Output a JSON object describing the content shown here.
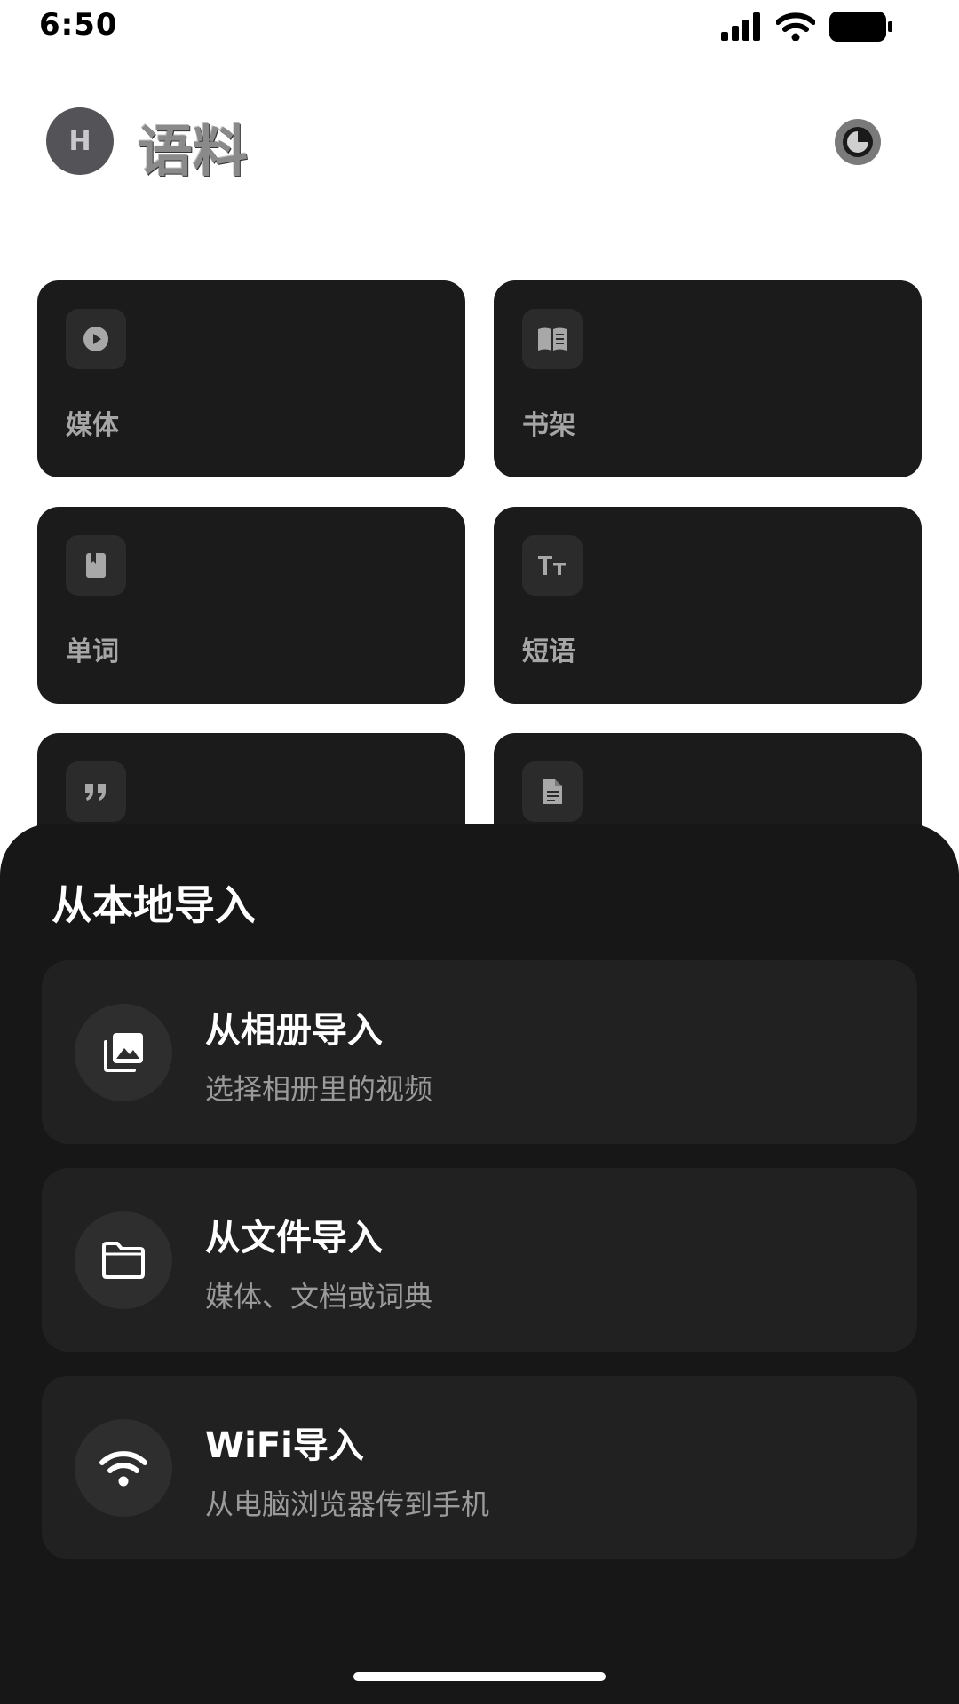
{
  "status_bar": {
    "time": "6:50"
  },
  "header": {
    "avatar_initial": "H",
    "title": "语料"
  },
  "grid": {
    "items": [
      {
        "label": "媒体",
        "icon": "play-circle-icon"
      },
      {
        "label": "书架",
        "icon": "open-book-icon"
      },
      {
        "label": "单词",
        "icon": "bookmark-book-icon"
      },
      {
        "label": "短语",
        "icon": "text-size-icon"
      },
      {
        "label": "",
        "icon": "quote-icon"
      },
      {
        "label": "",
        "icon": "document-icon"
      }
    ]
  },
  "sheet": {
    "title": "从本地导入",
    "options": [
      {
        "title": "从相册导入",
        "subtitle": "选择相册里的视频",
        "icon": "photo-library-icon"
      },
      {
        "title": "从文件导入",
        "subtitle": "媒体、文档或词典",
        "icon": "folder-icon"
      },
      {
        "title": "WiFi导入",
        "subtitle": "从电脑浏览器传到手机",
        "icon": "wifi-icon"
      }
    ]
  },
  "colors": {
    "background": "#ffffff",
    "card": "#1b1b1b",
    "sheet": "#171717",
    "option": "#212121",
    "accent_text": "#ffffff",
    "muted_text": "#9a9a9a"
  }
}
